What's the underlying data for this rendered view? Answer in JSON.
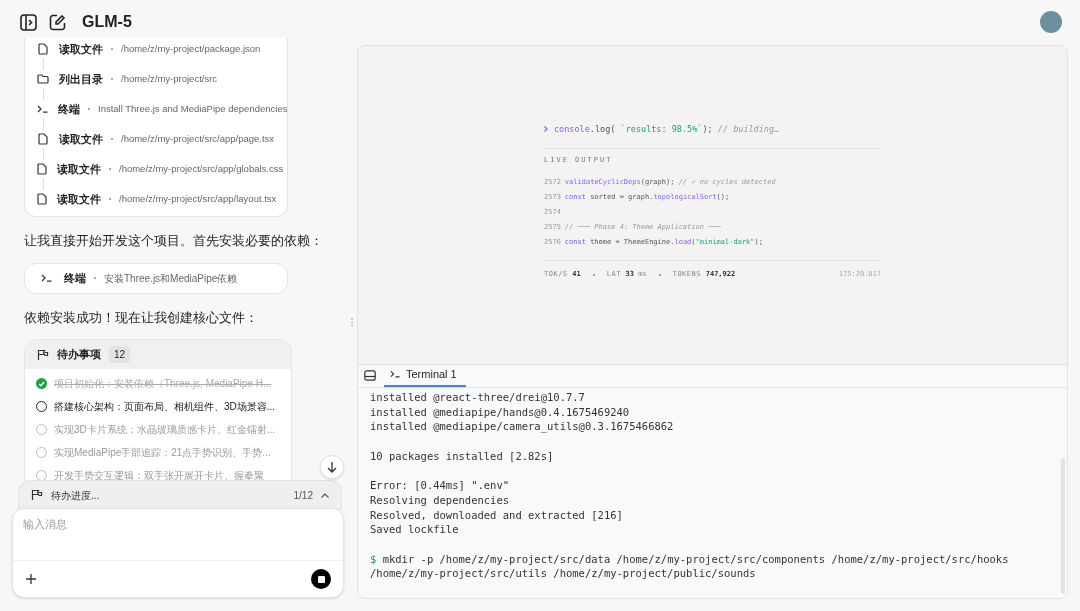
{
  "header": {
    "title": "GLM-5"
  },
  "tool_calls": [
    {
      "kind": "file",
      "label": "读取文件",
      "detail": "/home/z/my-project/package.json"
    },
    {
      "kind": "folder",
      "label": "列出目录",
      "detail": "/home/z/my-project/src"
    },
    {
      "kind": "terminal",
      "label": "终端",
      "detail": "Install Three.js and MediaPipe dependencies"
    },
    {
      "kind": "file",
      "label": "读取文件",
      "detail": "/home/z/my-project/src/app/page.tsx"
    },
    {
      "kind": "file",
      "label": "读取文件",
      "detail": "/home/z/my-project/src/app/globals.css"
    },
    {
      "kind": "file",
      "label": "读取文件",
      "detail": "/home/z/my-project/src/app/layout.tsx"
    }
  ],
  "message_1": "让我直接开始开发这个项目。首先安装必要的依赖：",
  "terminal_call": {
    "label": "终端",
    "detail": "安装Three.js和MediaPipe依赖"
  },
  "message_2": "依赖安装成功！现在让我创建核心文件：",
  "todo": {
    "title": "待办事项",
    "count": "12",
    "items": [
      {
        "kind": "done",
        "text": "项目初始化：安装依赖（Three.js, MediaPipe H..."
      },
      {
        "kind": "active",
        "text": "搭建核心架构：页面布局、相机组件、3D场景容..."
      },
      {
        "kind": "pending",
        "text": "实现3D卡片系统：水晶玻璃质感卡片、红金镭射..."
      },
      {
        "kind": "pending",
        "text": "实现MediaPipe手部追踪：21点手势识别、手势..."
      },
      {
        "kind": "pending",
        "text": "开发手势交互逻辑：双手张开展开卡片、握拳聚"
      }
    ]
  },
  "progress": {
    "label": "待办进度...",
    "count": "1/12",
    "expanded": false
  },
  "composer": {
    "placeholder": "输入消息"
  },
  "preview": {
    "prompt": [
      {
        "kind": "fn",
        "text": "console"
      },
      {
        "kind": "plain",
        "text": ".log( "
      },
      {
        "kind": "string",
        "text": "`results: 98.5%`"
      },
      {
        "kind": "plain",
        "text": "); "
      },
      {
        "kind": "comment",
        "text": "// building…"
      }
    ],
    "live_label": "LIVE OUTPUT",
    "lines": [
      {
        "number": "2572",
        "tokens": [
          {
            "kind": "fn",
            "text": "validateCyclicDeps"
          },
          {
            "kind": "plain",
            "text": "(graph); "
          },
          {
            "kind": "comment",
            "text": "// ✓ no cycles detected"
          }
        ]
      },
      {
        "number": "2573",
        "tokens": [
          {
            "kind": "keyword",
            "text": "const"
          },
          {
            "kind": "plain",
            "text": " sorted = graph."
          },
          {
            "kind": "fn",
            "text": "topologicalSort"
          },
          {
            "kind": "plain",
            "text": "();"
          }
        ]
      },
      {
        "number": "2574"
      },
      {
        "number": "2575",
        "tokens": [
          {
            "kind": "comment",
            "text": "// ─── Phase 4: Theme Application ───"
          }
        ]
      },
      {
        "number": "2576",
        "tokens": [
          {
            "kind": "keyword",
            "text": "const"
          },
          {
            "kind": "plain",
            "text": " theme = ThemeEngine."
          },
          {
            "kind": "fn",
            "text": "load"
          },
          {
            "kind": "plain",
            "text": "("
          },
          {
            "kind": "string",
            "text": "\"minimal-dark\""
          },
          {
            "kind": "plain",
            "text": ");"
          }
        ]
      }
    ],
    "stats": [
      {
        "label": "TOK/S",
        "value": "41"
      },
      {
        "label": "LAT",
        "value": "33",
        "unit": "ms"
      },
      {
        "label": "TOKENS",
        "value": "747,922"
      }
    ],
    "clock": "175:20.817"
  },
  "terminal": {
    "tab": "Terminal 1",
    "lines": [
      {
        "kind": "output",
        "text": "installed @react-three/drei@10.7.7"
      },
      {
        "kind": "output",
        "text": "installed @mediapipe/hands@0.4.1675469240"
      },
      {
        "kind": "output",
        "text": "installed @mediapipe/camera_utils@0.3.1675466862"
      },
      {
        "kind": "blank"
      },
      {
        "kind": "output",
        "text": "10 packages installed [2.82s]"
      },
      {
        "kind": "blank"
      },
      {
        "kind": "output",
        "text": "Error: [0.44ms] \".env\""
      },
      {
        "kind": "output",
        "text": "Resolving dependencies"
      },
      {
        "kind": "output",
        "text": "Resolved, downloaded and extracted [216]"
      },
      {
        "kind": "output",
        "text": "Saved lockfile"
      },
      {
        "kind": "blank"
      },
      {
        "kind": "command",
        "prompt": "$",
        "text": "mkdir -p /home/z/my-project/src/data /home/z/my-project/src/components /home/z/my-project/src/hooks /home/z/my-project/src/utils /home/z/my-project/public/sounds"
      }
    ]
  }
}
